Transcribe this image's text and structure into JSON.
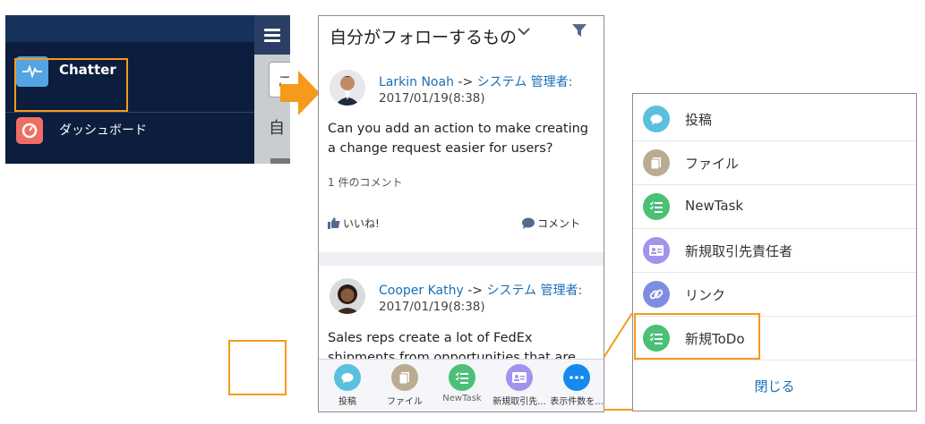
{
  "sidebar": {
    "items": [
      {
        "label": "Chatter",
        "icon": "chatter-icon",
        "color": "#54a4e2"
      },
      {
        "label": "ダッシュボード",
        "icon": "dashboard-icon",
        "color": "#ef6e64"
      }
    ],
    "peek_text": "自"
  },
  "feed": {
    "title": "自分がフォローするもの",
    "posts": [
      {
        "author": "Larkin Noah",
        "arrow": " -> ",
        "target": "システム 管理者:",
        "date": "2017/01/19(8:38)",
        "body": "Can you add an action to make creating a change request easier for users?",
        "comment_count": "1 件のコメント",
        "like_label": "いいね!",
        "comment_label": "コメント"
      },
      {
        "author": "Cooper Kathy",
        "arrow": " -> ",
        "target": "システム 管理者:",
        "date": "2017/01/19(8:38)",
        "body": "Sales reps create a lot of FedEx shipments from opportunities that are"
      }
    ],
    "toolbar": [
      {
        "label": "投稿",
        "icon": "post-icon",
        "color": "#5bc0de"
      },
      {
        "label": "ファイル",
        "icon": "file-icon",
        "color": "#baac93"
      },
      {
        "label": "NewTask",
        "icon": "task-icon",
        "color": "#4bc076"
      },
      {
        "label": "新規取引先...",
        "icon": "contact-icon",
        "color": "#a094ed"
      },
      {
        "label": "表示件数を...",
        "icon": "more-icon",
        "color": "#1589ee"
      }
    ]
  },
  "action_menu": {
    "items": [
      {
        "label": "投稿",
        "icon": "post-icon",
        "color": "#5bc0de"
      },
      {
        "label": "ファイル",
        "icon": "file-icon",
        "color": "#baac93"
      },
      {
        "label": "NewTask",
        "icon": "task-icon",
        "color": "#4bc076"
      },
      {
        "label": "新規取引先責任者",
        "icon": "contact-icon",
        "color": "#a094ed"
      },
      {
        "label": "リンク",
        "icon": "link-icon",
        "color": "#7f8de1"
      },
      {
        "label": "新規ToDo",
        "icon": "task-icon",
        "color": "#4bc076"
      }
    ],
    "close_label": "閉じる"
  },
  "colors": {
    "highlight": "#f59a1a",
    "link": "#1b6fb5",
    "nav_bg": "#0c1d3d"
  }
}
